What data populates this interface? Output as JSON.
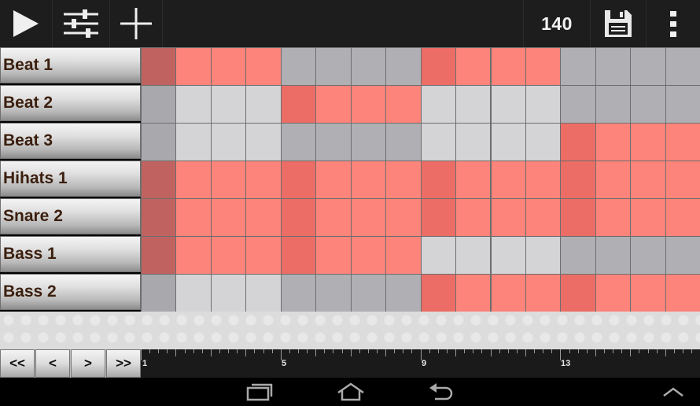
{
  "toolbar": {
    "bpm": "140"
  },
  "tracks": [
    {
      "name": "Beat 1"
    },
    {
      "name": "Beat 2"
    },
    {
      "name": "Beat 3"
    },
    {
      "name": "Hihats 1"
    },
    {
      "name": "Snare 2"
    },
    {
      "name": "Bass 1"
    },
    {
      "name": "Bass 2"
    }
  ],
  "pattern": [
    [
      1,
      1,
      1,
      1,
      0,
      0,
      0,
      0,
      1,
      1,
      1,
      1,
      0,
      0,
      0,
      0
    ],
    [
      0,
      0,
      0,
      0,
      1,
      1,
      1,
      1,
      0,
      0,
      0,
      0,
      0,
      0,
      0,
      0
    ],
    [
      0,
      0,
      0,
      0,
      0,
      0,
      0,
      0,
      0,
      0,
      0,
      0,
      1,
      1,
      1,
      1
    ],
    [
      1,
      1,
      1,
      1,
      1,
      1,
      1,
      1,
      1,
      1,
      1,
      1,
      1,
      1,
      1,
      1
    ],
    [
      1,
      1,
      1,
      1,
      1,
      1,
      1,
      1,
      1,
      1,
      1,
      1,
      1,
      1,
      1,
      1
    ],
    [
      1,
      1,
      1,
      1,
      1,
      1,
      1,
      1,
      0,
      0,
      0,
      0,
      0,
      0,
      0,
      0
    ],
    [
      0,
      0,
      0,
      0,
      0,
      0,
      0,
      0,
      1,
      1,
      1,
      1,
      1,
      1,
      1,
      1
    ]
  ],
  "current_step": 1,
  "colors": {
    "step_on": "#fd847b",
    "step_on_beat": "#ec6d65",
    "step_on_current": "#c06360",
    "step_off_light": "#d4d4d6",
    "step_off_dark": "#b0b0b4",
    "step_off_current": "#a9a9ad"
  },
  "navigation": {
    "first": "<<",
    "prev": "<",
    "next": ">",
    "last": ">>"
  },
  "timeline": {
    "markers": [
      "1",
      "5",
      "9",
      "13"
    ]
  },
  "icons": {
    "play": "play-icon",
    "mixer": "sliders-icon",
    "add": "plus-icon",
    "save": "floppy-disk-icon",
    "menu": "overflow-menu-icon",
    "recent_apps": "recent-apps-icon",
    "home": "home-icon",
    "back": "back-icon",
    "collapse": "chevron-up-icon"
  }
}
